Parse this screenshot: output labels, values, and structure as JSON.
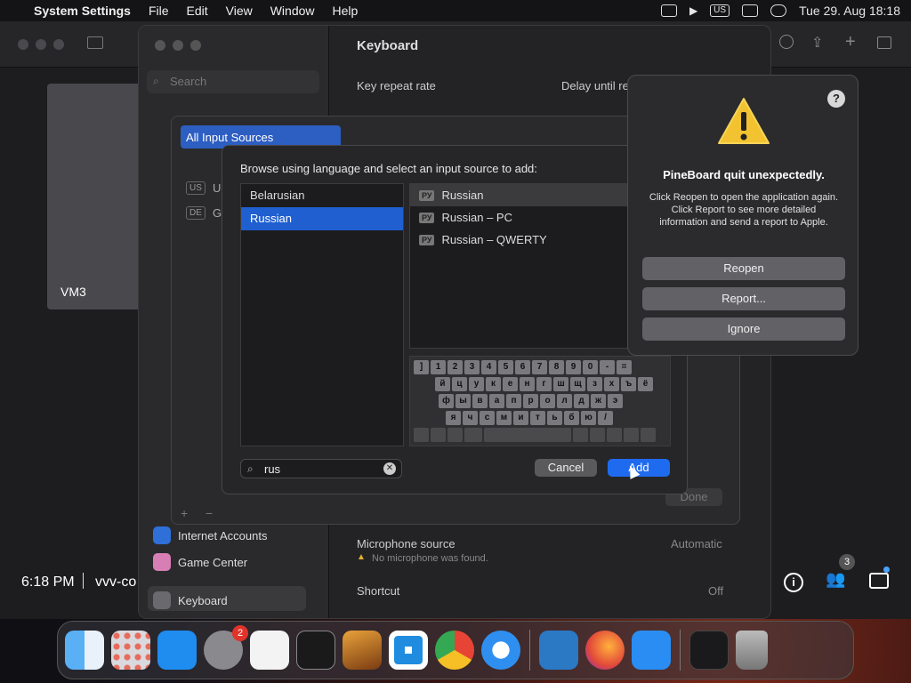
{
  "menubar": {
    "app_name": "System Settings",
    "items": [
      "File",
      "Edit",
      "View",
      "Window",
      "Help"
    ],
    "input_badge": "US",
    "clock": "Tue 29. Aug  18:18"
  },
  "vm": {
    "name": "VM3",
    "time": "6:18 PM",
    "session_label": "vvv-co"
  },
  "settings": {
    "title": "Keyboard",
    "search_placeholder": "Search",
    "key_repeat_label": "Key repeat rate",
    "delay_label": "Delay until re",
    "sidebar_internet_accounts": "Internet Accounts",
    "sidebar_game_center": "Game Center",
    "sidebar_keyboard": "Keyboard",
    "microphone_label": "Microphone source",
    "microphone_value": "Automatic",
    "microphone_warning": "No microphone was found.",
    "shortcut_label": "Shortcut",
    "shortcut_value": "Off",
    "done_label": "Done"
  },
  "input_sources_sheet": {
    "selected_tab": "All Input Sources",
    "items": [
      {
        "badge": "US",
        "label": "U"
      },
      {
        "badge": "DE",
        "label": "G"
      }
    ],
    "plus": "+",
    "minus": "−"
  },
  "add_dialog": {
    "prompt": "Browse using language and select an input source to add:",
    "languages": [
      "Belarusian",
      "Russian"
    ],
    "selected_language": "Russian",
    "sources": [
      {
        "badge": "РУ",
        "label": "Russian"
      },
      {
        "badge": "РУ",
        "label": "Russian – PC"
      },
      {
        "badge": "РУ",
        "label": "Russian – QWERTY"
      }
    ],
    "keyboard_rows": [
      [
        "]",
        "1",
        "2",
        "3",
        "4",
        "5",
        "6",
        "7",
        "8",
        "9",
        "0",
        "-",
        "="
      ],
      [
        "й",
        "ц",
        "у",
        "к",
        "е",
        "н",
        "г",
        "ш",
        "щ",
        "з",
        "х",
        "ъ",
        "ё"
      ],
      [
        "ф",
        "ы",
        "в",
        "а",
        "п",
        "р",
        "о",
        "л",
        "д",
        "ж",
        "э"
      ],
      [
        "я",
        "ч",
        "с",
        "м",
        "и",
        "т",
        "ь",
        "б",
        "ю",
        "/"
      ]
    ],
    "search_value": "rus",
    "cancel_label": "Cancel",
    "add_label": "Add"
  },
  "alert": {
    "help": "?",
    "title": "PineBoard quit unexpectedly.",
    "body": "Click Reopen to open the application again. Click Report to see more detailed information and send a report to Apple.",
    "buttons": [
      "Reopen",
      "Report...",
      "Ignore"
    ]
  },
  "overlay": {
    "participants_count": "3"
  },
  "dock": {
    "items": [
      "finder",
      "launchpad",
      "app-store",
      "system-settings",
      "textedit",
      "terminal",
      "garageband",
      "vscode",
      "chrome",
      "safari",
      "remote-desktop",
      "firefox",
      "xcode-app",
      "screen-sharing",
      "trash"
    ],
    "system_settings_badge": "2"
  }
}
